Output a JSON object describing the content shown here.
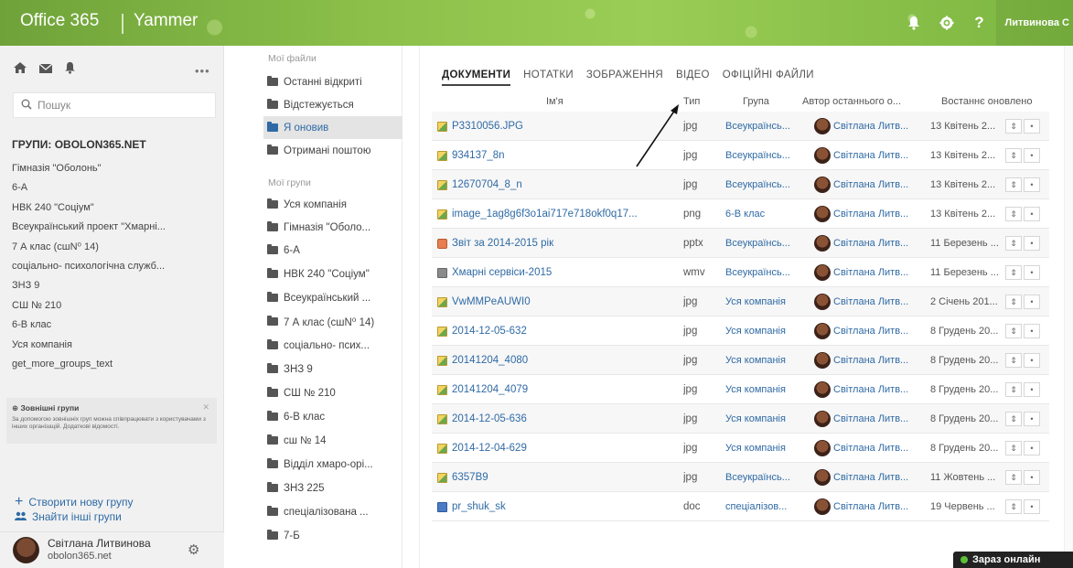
{
  "topbar": {
    "brand": "Office 365",
    "app": "Yammer",
    "user": "Литвинова С",
    "icons": [
      "bell-icon",
      "gear-icon",
      "help-icon"
    ]
  },
  "left": {
    "search_placeholder": "Пошук",
    "groups_title": "ГРУПИ: OBOLON365.NET",
    "groups": [
      "Гімназія \"Оболонь\"",
      "6-А",
      "НВК 240 \"Соціум\"",
      "Всеукраїнський проект \"Хмарні...",
      "7 А клас (сшN⁰ 14)",
      "соціально- психологічна служб...",
      "ЗНЗ 9",
      "СШ № 210",
      "6-В клас",
      "Уся компанія",
      "get_more_groups_text"
    ],
    "external": {
      "title": "Зовнішні групи",
      "text": "За допомогою зовнішніх груп можна співпрацювати з користувачами з інших організацій. Додаткові відомості."
    },
    "create_group": "Створити нову групу",
    "find_groups": "Знайти інші групи",
    "user_name": "Світлана Литвинова",
    "user_org": "obolon365.net"
  },
  "mid": {
    "files_heading": "Мої файли",
    "files": [
      "Останні відкриті",
      "Відстежується",
      "Я оновив",
      "Отримані поштою"
    ],
    "groups_heading": "Мої групи",
    "groups": [
      "Уся компанія",
      "Гімназія \"Оболо...",
      "6-А",
      "НВК 240 \"Соціум\"",
      "Всеукраїнський ...",
      "7 А клас (сшN⁰ 14)",
      "соціально- псих...",
      "ЗНЗ 9",
      "СШ № 210",
      "6-В клас",
      "сш № 14",
      "Відділ хмаро-орі...",
      "ЗНЗ 225",
      "спеціалізована ...",
      "7-Б"
    ]
  },
  "main": {
    "tabs": [
      "ДОКУМЕНТИ",
      "НОТАТКИ",
      "ЗОБРАЖЕННЯ",
      "ВІДЕО",
      "ОФІЦІЙНІ ФАЙЛИ"
    ],
    "columns": [
      "Ім'я",
      "Тип",
      "Група",
      "Автор останнього о...",
      "Востаннє оновлено"
    ],
    "rows": [
      {
        "name": "P3310056.JPG",
        "type": "jpg",
        "group": "Всеукраїнсь...",
        "author": "Світлана Литв...",
        "date": "13 Квітень 2...",
        "icon": "image"
      },
      {
        "name": "934137_8n",
        "type": "jpg",
        "group": "Всеукраїнсь...",
        "author": "Світлана Литв...",
        "date": "13 Квітень 2...",
        "icon": "image"
      },
      {
        "name": "12670704_8_n",
        "type": "jpg",
        "group": "Всеукраїнсь...",
        "author": "Світлана Литв...",
        "date": "13 Квітень 2...",
        "icon": "image"
      },
      {
        "name": "image_1ag8g6f3o1ai717e718okf0q17...",
        "type": "png",
        "group": "6-В клас",
        "author": "Світлана Литв...",
        "date": "13 Квітень 2...",
        "icon": "image"
      },
      {
        "name": "Звіт за 2014-2015 рік",
        "type": "pptx",
        "group": "Всеукраїнсь...",
        "author": "Світлана Литв...",
        "date": "11 Березень ...",
        "icon": "ppt"
      },
      {
        "name": "Хмарні сервіси-2015",
        "type": "wmv",
        "group": "Всеукраїнсь...",
        "author": "Світлана Литв...",
        "date": "11 Березень ...",
        "icon": "video"
      },
      {
        "name": "VwMMPeAUWI0",
        "type": "jpg",
        "group": "Уся компанія",
        "author": "Світлана Литв...",
        "date": "2 Січень 201...",
        "icon": "image"
      },
      {
        "name": "2014-12-05-632",
        "type": "jpg",
        "group": "Уся компанія",
        "author": "Світлана Литв...",
        "date": "8 Грудень 20...",
        "icon": "image"
      },
      {
        "name": "20141204_4080",
        "type": "jpg",
        "group": "Уся компанія",
        "author": "Світлана Литв...",
        "date": "8 Грудень 20...",
        "icon": "image"
      },
      {
        "name": "20141204_4079",
        "type": "jpg",
        "group": "Уся компанія",
        "author": "Світлана Литв...",
        "date": "8 Грудень 20...",
        "icon": "image"
      },
      {
        "name": "2014-12-05-636",
        "type": "jpg",
        "group": "Уся компанія",
        "author": "Світлана Литв...",
        "date": "8 Грудень 20...",
        "icon": "image"
      },
      {
        "name": "2014-12-04-629",
        "type": "jpg",
        "group": "Уся компанія",
        "author": "Світлана Литв...",
        "date": "8 Грудень 20...",
        "icon": "image"
      },
      {
        "name": "6357B9",
        "type": "jpg",
        "group": "Всеукраїнсь...",
        "author": "Світлана Литв...",
        "date": "11 Жовтень ...",
        "icon": "image"
      },
      {
        "name": "pr_shuk_sk",
        "type": "doc",
        "group": "спеціалізов...",
        "author": "Світлана Литв...",
        "date": "19 Червень ...",
        "icon": "doc"
      }
    ]
  },
  "online_label": "Зараз онлайн"
}
